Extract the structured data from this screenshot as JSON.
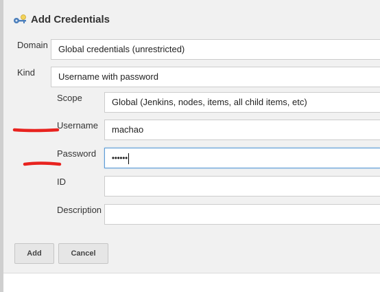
{
  "dialog": {
    "title": "Add Credentials",
    "icon": "key-icon"
  },
  "form": {
    "domain": {
      "label": "Domain",
      "value": "Global credentials (unrestricted)"
    },
    "kind": {
      "label": "Kind",
      "value": "Username with password"
    },
    "scope": {
      "label": "Scope",
      "value": "Global (Jenkins, nodes, items, all child items, etc)"
    },
    "username": {
      "label": "Username",
      "value": "machao"
    },
    "password": {
      "label": "Password",
      "masked_value": "••••••"
    },
    "id": {
      "label": "ID",
      "value": ""
    },
    "description": {
      "label": "Description",
      "value": ""
    }
  },
  "buttons": {
    "add": "Add",
    "cancel": "Cancel"
  },
  "colors": {
    "annotation": "#e8231f",
    "focus_border": "#5b9bd5",
    "dialog_bg": "#f1f1f1"
  }
}
